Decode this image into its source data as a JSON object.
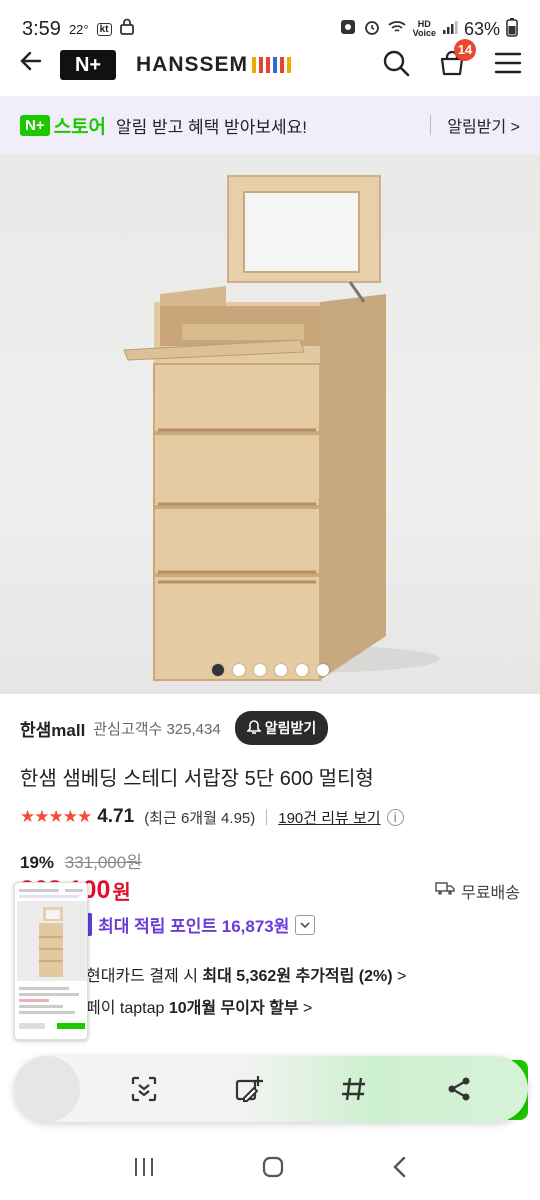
{
  "status": {
    "time": "3:59",
    "temp": "22°",
    "carrier": "kt",
    "voice": "HD Voice",
    "battery": "63%"
  },
  "header": {
    "back_icon": "arrow-left-icon",
    "nplus_logo": "N+",
    "brand": "HANSSEM",
    "cart_count": "14",
    "icons": [
      "search-icon",
      "cart-icon",
      "menu-icon"
    ]
  },
  "promo": {
    "badge": "N+",
    "store": "스토어",
    "message": "알림 받고 혜택 받아보세요!",
    "action": "알림받기 >"
  },
  "carousel": {
    "total": 6,
    "active_index": 0
  },
  "seller": {
    "name": "한샘mall",
    "fans_label": "관심고객수 325,434",
    "notify_button": "알림받기"
  },
  "product": {
    "title": "한샘 샘베딩 스테디 서랍장 5단 600 멀티형",
    "rating_stars": "★★★★★",
    "rating": "4.71",
    "recent_rating": "(최근 6개월 4.95)",
    "review_link": "190건 리뷰 보기",
    "discount": "19%",
    "original_price": "331,000원",
    "sale_price": "268,100",
    "currency": "원",
    "shipping": "무료배송",
    "points_tag": "적립",
    "points": "최대 적립 포인트 16,873원",
    "card_benefit_prefix": "현대카드 결제 시 ",
    "card_benefit_bold": "최대 5,362원 추가적립 (2%)",
    "card_benefit_suffix": " >",
    "pay_prefix": "페이 taptap ",
    "pay_bold": "10개월 무이자 할부",
    "pay_suffix": " >"
  },
  "toolbar": {
    "icons": [
      "scan-text-icon",
      "edit-add-icon",
      "hashtag-icon",
      "share-icon"
    ]
  },
  "navbar": {
    "icons": [
      "recent-apps-icon",
      "home-icon",
      "back-icon"
    ]
  },
  "colors": {
    "accent_green": "#1ec800",
    "price_red": "#e0102c",
    "point_purple": "#6a3dd6",
    "star_red": "#f44a3a"
  }
}
